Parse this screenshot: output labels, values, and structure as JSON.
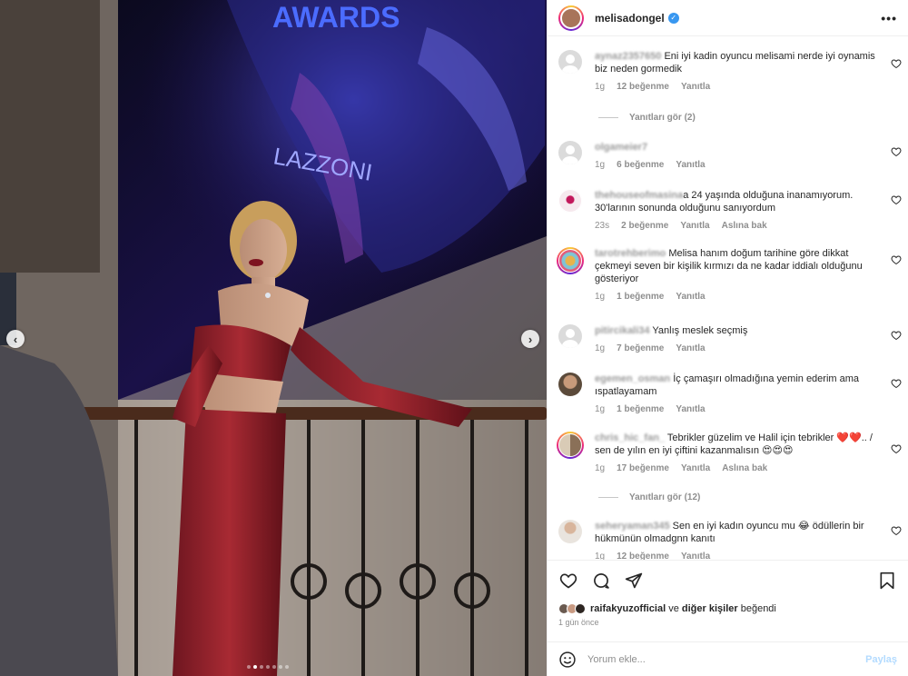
{
  "post": {
    "username": "melisadongel",
    "verified_mark": "✓",
    "more_label": "•••"
  },
  "photo": {
    "screen_text_top": "AWARDS",
    "screen_text_brand": "LAZZONI",
    "prev_label": "‹",
    "next_label": "›",
    "dots_count": 7,
    "active_dot": 1
  },
  "comments": [
    {
      "user": "aynaz2357650",
      "text": "Eni iyi kadin oyuncu melisami nerde iyi oynamis biz neden gormedik",
      "time": "1g",
      "likes": "12 beğenme",
      "reply": "Yanıtla",
      "extra": ""
    },
    {
      "user": "olgameier7",
      "text": "",
      "time": "1g",
      "likes": "6 beğenme",
      "reply": "Yanıtla",
      "extra": ""
    },
    {
      "user": "thehouseofmasina",
      "text": "a 24 yaşında olduğuna inanamıyorum. 30'larının sonunda olduğunu sanıyordum",
      "time": "23s",
      "likes": "2 beğenme",
      "reply": "Yanıtla",
      "extra": "Aslına bak"
    },
    {
      "user": "tarotrehberimo",
      "text": "Melisa hanım doğum tarihine göre dikkat çekmeyi seven bir kişilik kırmızı da ne kadar iddialı olduğunu gösteriyor",
      "time": "1g",
      "likes": "1 beğenme",
      "reply": "Yanıtla",
      "extra": ""
    },
    {
      "user": "pitircikali34",
      "text": "Yanlış meslek seçmiş",
      "time": "1g",
      "likes": "7 beğenme",
      "reply": "Yanıtla",
      "extra": ""
    },
    {
      "user": "egemen_osman",
      "text": "İç çamaşırı olmadığına yemin ederim ama ıspatlayamam",
      "time": "1g",
      "likes": "1 beğenme",
      "reply": "Yanıtla",
      "extra": ""
    },
    {
      "user": "chris_hic_fan_",
      "text": "Tebrikler güzelim ve Halil için tebrikler ❤️❤️.. / sen de yılın en iyi çiftini kazanmalısın 😍😍😍",
      "time": "1g",
      "likes": "17 beğenme",
      "reply": "Yanıtla",
      "extra": "Aslına bak"
    },
    {
      "user": "seheryaman345",
      "text": "Sen en iyi kadın oyuncu mu 😂 ödüllerin bir hükmünün olmadgnn kanıtı",
      "time": "1g",
      "likes": "12 beğenme",
      "reply": "Yanıtla",
      "extra": ""
    }
  ],
  "replies": [
    {
      "label": "Yanıtları gör (2)"
    },
    {
      "label": "Yanıtları gör (12)"
    }
  ],
  "footer": {
    "liked_by_user": "raifakyuzofficial",
    "liked_by_join": "ve",
    "liked_by_others": "diğer kişiler",
    "liked_by_suffix": "beğendi",
    "time_ago": "1 gün önce",
    "comment_placeholder": "Yorum ekle...",
    "post_label": "Paylaş"
  },
  "colors": {
    "accent": "#3897f0",
    "post_disabled": "#b3dbff",
    "heart_red": "#ed4956"
  },
  "icons": [
    "heart-icon",
    "comment-icon",
    "share-icon",
    "save-icon",
    "emoji-icon",
    "verified-icon",
    "more-icon"
  ]
}
